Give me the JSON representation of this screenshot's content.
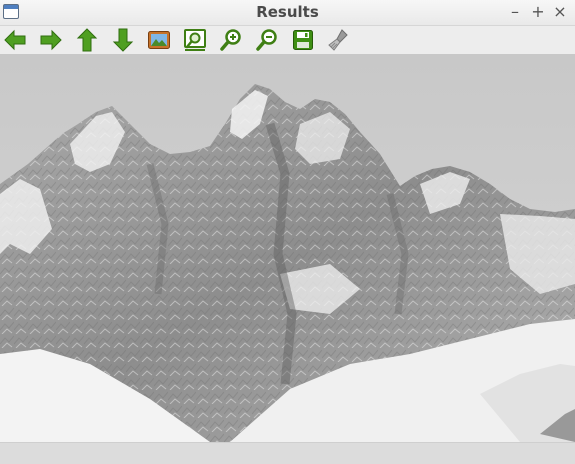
{
  "window": {
    "title": "Results",
    "controls": {
      "minimize": "–",
      "maximize": "+",
      "close": "×"
    }
  },
  "toolbar": {
    "buttons": [
      {
        "name": "back",
        "icon": "arrow-left-icon",
        "color": "#4a9a1d"
      },
      {
        "name": "forward",
        "icon": "arrow-right-icon",
        "color": "#4a9a1d"
      },
      {
        "name": "up",
        "icon": "arrow-up-icon",
        "color": "#4a9a1d"
      },
      {
        "name": "down",
        "icon": "arrow-down-icon",
        "color": "#4a9a1d"
      },
      {
        "name": "image",
        "icon": "image-icon",
        "color": "#b8651e"
      },
      {
        "name": "zoom-fit",
        "icon": "zoom-fit-icon",
        "color": "#3f7f14"
      },
      {
        "name": "zoom-in",
        "icon": "zoom-in-icon",
        "color": "#3f7f14"
      },
      {
        "name": "zoom-out",
        "icon": "zoom-out-icon",
        "color": "#3f7f14"
      },
      {
        "name": "save",
        "icon": "save-icon",
        "color": "#3f8f14"
      },
      {
        "name": "clear",
        "icon": "brush-icon",
        "color": "#8a8a8a"
      }
    ]
  },
  "content": {
    "image": "grayscale-snowy-mountain-peaks-photo"
  },
  "colors": {
    "titlebar": "#efefef",
    "toolbar": "#ededed",
    "icon_green": "#4a9a1d",
    "statusbar": "#dcdcdc"
  }
}
